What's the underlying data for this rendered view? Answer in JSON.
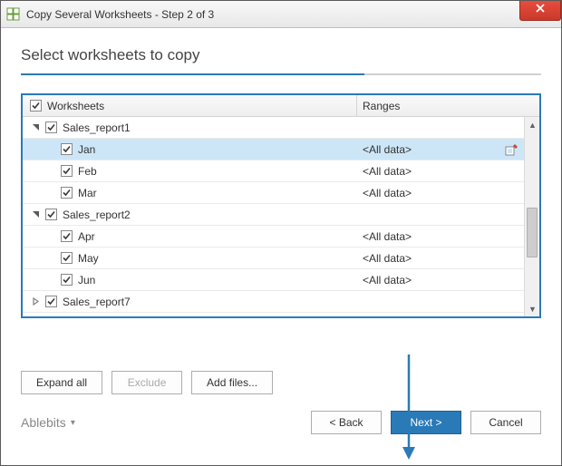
{
  "window": {
    "title": "Copy Several Worksheets - Step 2 of 3"
  },
  "heading": "Select worksheets to copy",
  "columns": {
    "worksheets": "Worksheets",
    "ranges": "Ranges"
  },
  "tree": [
    {
      "level": 0,
      "name": "Sales_report1",
      "expanded": true,
      "checked": true,
      "range": "",
      "selected": false
    },
    {
      "level": 1,
      "name": "Jan",
      "checked": true,
      "range": "<All data>",
      "selected": true
    },
    {
      "level": 1,
      "name": "Feb",
      "checked": true,
      "range": "<All data>",
      "selected": false
    },
    {
      "level": 1,
      "name": "Mar",
      "checked": true,
      "range": "<All data>",
      "selected": false
    },
    {
      "level": 0,
      "name": "Sales_report2",
      "expanded": true,
      "checked": true,
      "range": "",
      "selected": false
    },
    {
      "level": 1,
      "name": "Apr",
      "checked": true,
      "range": "<All data>",
      "selected": false
    },
    {
      "level": 1,
      "name": "May",
      "checked": true,
      "range": "<All data>",
      "selected": false
    },
    {
      "level": 1,
      "name": "Jun",
      "checked": true,
      "range": "<All data>",
      "selected": false
    },
    {
      "level": 0,
      "name": "Sales_report7",
      "expanded": false,
      "checked": true,
      "range": "",
      "selected": false
    }
  ],
  "buttons": {
    "expand_all": "Expand all",
    "exclude": "Exclude",
    "add_files": "Add files...",
    "back": "<  Back",
    "next": "Next  >",
    "cancel": "Cancel"
  },
  "brand": "Ablebits"
}
